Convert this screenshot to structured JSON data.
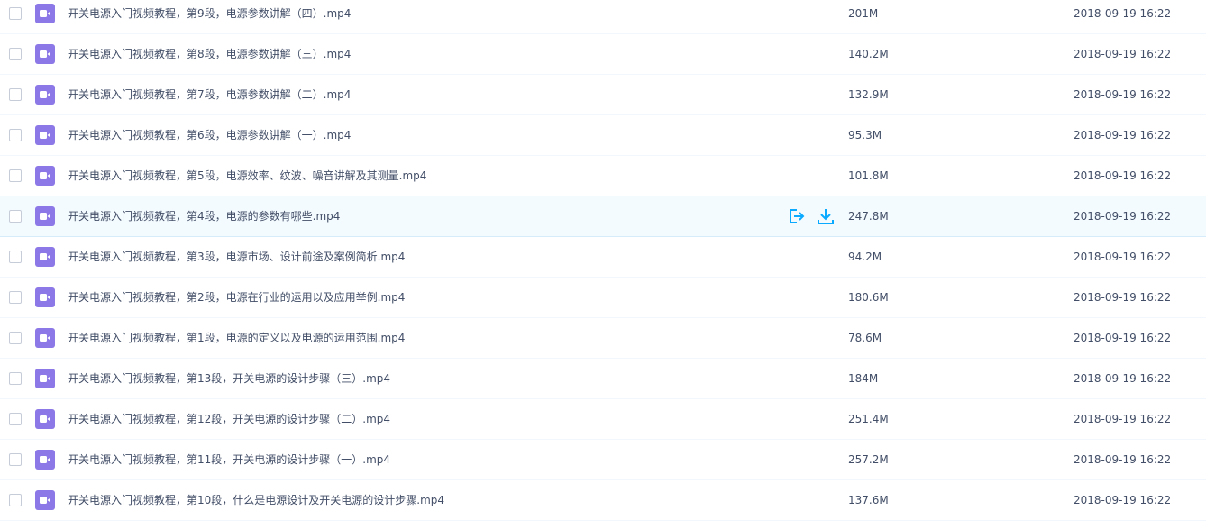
{
  "colors": {
    "icon_bg": "#8c78e6",
    "action": "#09aaff",
    "row_hover": "#f4fbff"
  },
  "files": [
    {
      "name": "开关电源入门视频教程，第9段，电源参数讲解（四）.mp4",
      "size": "201M",
      "time": "2018-09-19 16:22",
      "icon": "video-icon"
    },
    {
      "name": "开关电源入门视频教程，第8段，电源参数讲解（三）.mp4",
      "size": "140.2M",
      "time": "2018-09-19 16:22",
      "icon": "video-icon"
    },
    {
      "name": "开关电源入门视频教程，第7段，电源参数讲解（二）.mp4",
      "size": "132.9M",
      "time": "2018-09-19 16:22",
      "icon": "video-icon"
    },
    {
      "name": "开关电源入门视频教程，第6段，电源参数讲解（一）.mp4",
      "size": "95.3M",
      "time": "2018-09-19 16:22",
      "icon": "video-icon"
    },
    {
      "name": "开关电源入门视频教程，第5段，电源效率、纹波、噪音讲解及其测量.mp4",
      "size": "101.8M",
      "time": "2018-09-19 16:22",
      "icon": "video-icon"
    },
    {
      "name": "开关电源入门视频教程，第4段，电源的参数有哪些.mp4",
      "size": "247.8M",
      "time": "2018-09-19 16:22",
      "icon": "video-icon",
      "hover": true
    },
    {
      "name": "开关电源入门视频教程，第3段，电源市场、设计前途及案例简析.mp4",
      "size": "94.2M",
      "time": "2018-09-19 16:22",
      "icon": "video-icon"
    },
    {
      "name": "开关电源入门视频教程，第2段，电源在行业的运用以及应用举例.mp4",
      "size": "180.6M",
      "time": "2018-09-19 16:22",
      "icon": "video-icon"
    },
    {
      "name": "开关电源入门视频教程，第1段，电源的定义以及电源的运用范围.mp4",
      "size": "78.6M",
      "time": "2018-09-19 16:22",
      "icon": "video-icon"
    },
    {
      "name": "开关电源入门视频教程，第13段，开关电源的设计步骤（三）.mp4",
      "size": "184M",
      "time": "2018-09-19 16:22",
      "icon": "video-icon"
    },
    {
      "name": "开关电源入门视频教程，第12段，开关电源的设计步骤（二）.mp4",
      "size": "251.4M",
      "time": "2018-09-19 16:22",
      "icon": "video-icon"
    },
    {
      "name": "开关电源入门视频教程，第11段，开关电源的设计步骤（一）.mp4",
      "size": "257.2M",
      "time": "2018-09-19 16:22",
      "icon": "video-icon"
    },
    {
      "name": "开关电源入门视频教程，第10段，什么是电源设计及开关电源的设计步骤.mp4",
      "size": "137.6M",
      "time": "2018-09-19 16:22",
      "icon": "video-icon"
    }
  ],
  "hover_actions": [
    {
      "name": "share",
      "icon": "share-icon"
    },
    {
      "name": "download",
      "icon": "download-icon"
    }
  ]
}
